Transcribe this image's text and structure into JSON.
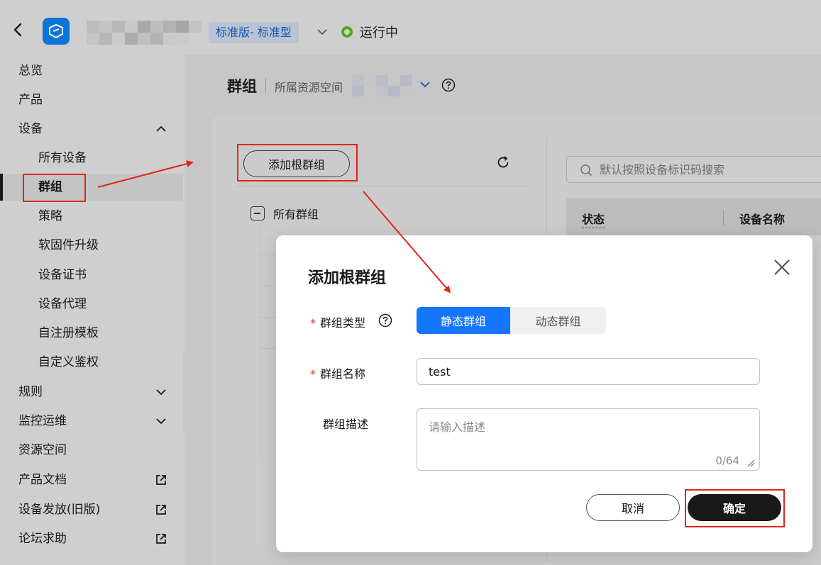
{
  "header": {
    "edition": "标准版- 标准型",
    "status": "运行中",
    "colors": {
      "status_ok": "#56a81a",
      "edition_text": "#1a55b6"
    }
  },
  "sidebar": {
    "items": [
      {
        "label": "总览"
      },
      {
        "label": "产品"
      },
      {
        "label": "设备",
        "icon": "chevron-up-icon"
      },
      {
        "label": "所有设备"
      },
      {
        "label": "群组",
        "active": true
      },
      {
        "label": "策略"
      },
      {
        "label": "软固件升级"
      },
      {
        "label": "设备证书"
      },
      {
        "label": "设备代理"
      },
      {
        "label": "自注册模板"
      },
      {
        "label": "自定义鉴权"
      },
      {
        "label": "规则",
        "icon": "chevron-down-icon"
      },
      {
        "label": "监控运维",
        "icon": "chevron-down-icon"
      },
      {
        "label": "资源空间"
      },
      {
        "label": "产品文档",
        "icon": "external-link-icon"
      },
      {
        "label": "设备发放(旧版)",
        "icon": "external-link-icon"
      },
      {
        "label": "论坛求助",
        "icon": "external-link-icon"
      }
    ]
  },
  "main": {
    "title": "群组",
    "workspace_label": "所属资源空间",
    "add_root_button": "添加根群组",
    "tree_root": "所有群组",
    "search_placeholder": "默认按照设备标识码搜索",
    "table_headers": [
      "状态",
      "设备名称"
    ]
  },
  "modal": {
    "title": "添加根群组",
    "group_type_label": "群组类型",
    "group_type_options": [
      "静态群组",
      "动态群组"
    ],
    "group_type_selected": "静态群组",
    "group_name_label": "群组名称",
    "group_name_value": "test",
    "group_desc_label": "群组描述",
    "group_desc_placeholder": "请输入描述",
    "counter": "0/64",
    "cancel": "取消",
    "confirm": "确定",
    "colors": {
      "primary": "#1476ff",
      "required": "#e0301e",
      "confirm_bg": "#191919"
    }
  },
  "annotation_color": "#e0251b"
}
